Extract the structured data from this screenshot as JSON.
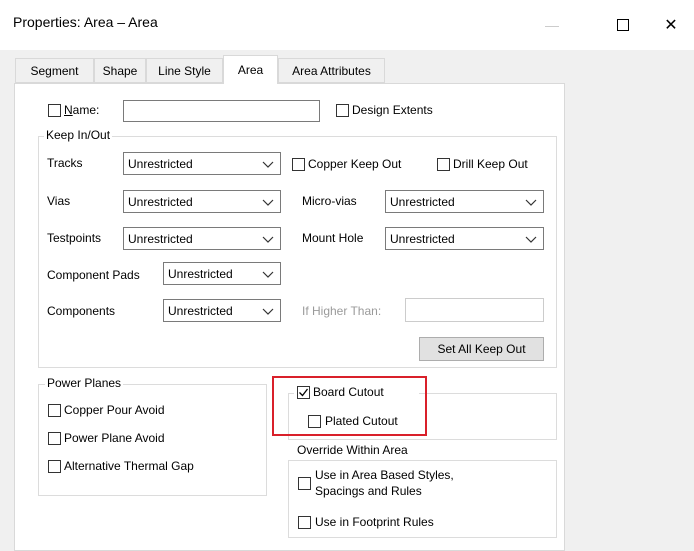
{
  "window": {
    "title": "Properties: Area – Area",
    "minimize": "—",
    "close": "✕"
  },
  "tabs": [
    {
      "label": "Segment"
    },
    {
      "label": "Shape"
    },
    {
      "label": "Line Style"
    },
    {
      "label": "Area",
      "active": true
    },
    {
      "label": "Area Attributes"
    }
  ],
  "name_row": {
    "name_label_prefix": "N",
    "name_label_rest": "ame:",
    "name_checked": false,
    "name_value": "",
    "design_extents_label": "Design Extents",
    "design_extents_checked": false
  },
  "keep_in_out": {
    "title": "Keep In/Out",
    "tracks": {
      "label": "Tracks",
      "value": "Unrestricted"
    },
    "vias": {
      "label": "Vias",
      "value": "Unrestricted"
    },
    "testpoints": {
      "label": "Testpoints",
      "value": "Unrestricted"
    },
    "component_pads": {
      "label": "Component Pads",
      "value": "Unrestricted"
    },
    "components": {
      "label": "Components",
      "value": "Unrestricted"
    },
    "copper_keep_out": {
      "label": "Copper  Keep Out",
      "checked": false
    },
    "drill_keep_out": {
      "label": "Drill  Keep Out",
      "checked": false
    },
    "micro_vias": {
      "label": "Micro-vias",
      "value": "Unrestricted"
    },
    "mount_hole": {
      "label": "Mount Hole",
      "value": "Unrestricted"
    },
    "if_higher_than": {
      "label": "If Higher Than:",
      "value": ""
    },
    "set_all_button": "Set All Keep Out"
  },
  "power_planes": {
    "title": "Power Planes",
    "copper_pour_avoid": {
      "label": "Copper Pour Avoid",
      "checked": false
    },
    "power_plane_avoid": {
      "label": "Power Plane Avoid",
      "checked": false
    },
    "alt_thermal_gap": {
      "label": "Alternative Thermal Gap",
      "checked": false
    }
  },
  "board_cutout": {
    "label": "Board Cutout",
    "checked": true,
    "plated_label": "Plated Cutout",
    "plated_checked": false
  },
  "override": {
    "title": "Override Within Area",
    "area_styles_line1": "Use in Area Based Styles,",
    "area_styles_line2": "Spacings and Rules",
    "area_styles_checked": false,
    "footprint_rules": "Use in Footprint Rules",
    "footprint_checked": false
  },
  "colors": {
    "highlight": "#d9202a"
  }
}
